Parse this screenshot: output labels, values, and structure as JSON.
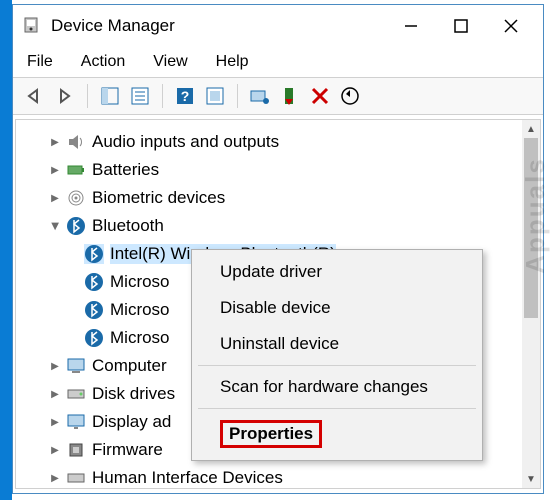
{
  "window": {
    "title": "Device Manager"
  },
  "menu": {
    "file": "File",
    "action": "Action",
    "view": "View",
    "help": "Help"
  },
  "tree": {
    "items": [
      {
        "label": "Audio inputs and outputs",
        "expanded": false
      },
      {
        "label": "Batteries",
        "expanded": false
      },
      {
        "label": "Biometric devices",
        "expanded": false
      },
      {
        "label": "Bluetooth",
        "expanded": true,
        "children": [
          {
            "label": "Intel(R) Wireless Bluetooth(R)",
            "selected": true
          },
          {
            "label": "Microso"
          },
          {
            "label": "Microso"
          },
          {
            "label": "Microso"
          }
        ]
      },
      {
        "label": "Computer",
        "expanded": false
      },
      {
        "label": "Disk drives",
        "expanded": false
      },
      {
        "label": "Display ad",
        "expanded": false
      },
      {
        "label": "Firmware",
        "expanded": false
      },
      {
        "label": "Human Interface Devices",
        "expanded": false
      }
    ]
  },
  "context_menu": {
    "update": "Update driver",
    "disable": "Disable device",
    "uninstall": "Uninstall device",
    "scan": "Scan for hardware changes",
    "properties": "Properties"
  },
  "watermark": "Appuals"
}
